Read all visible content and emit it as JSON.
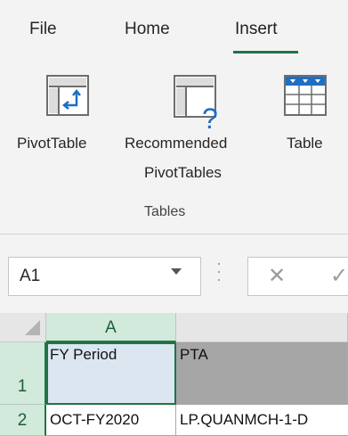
{
  "tabs": [
    {
      "label": "File"
    },
    {
      "label": "Home"
    },
    {
      "label": "Insert",
      "active": true
    }
  ],
  "commands": {
    "pivottable": {
      "label": "PivotTable"
    },
    "recommended": {
      "label_line1": "Recommended",
      "label_line2": "PivotTables"
    },
    "table": {
      "label": "Table"
    }
  },
  "group_label": "Tables",
  "namebox": {
    "value": "A1"
  },
  "formula_bar": {
    "cancel_glyph": "✕",
    "enter_glyph": "✓"
  },
  "grid": {
    "columns": [
      "A"
    ],
    "rows": [
      {
        "number": "1",
        "cells": [
          "FY Period",
          "PTA"
        ]
      },
      {
        "number": "2",
        "cells": [
          "OCT-FY2020",
          "LP.QUANMCH-1-D"
        ]
      }
    ]
  },
  "colors": {
    "accent": "#217346",
    "header_fill": "#dce6f1",
    "pta_fill": "#a6a6a6"
  }
}
